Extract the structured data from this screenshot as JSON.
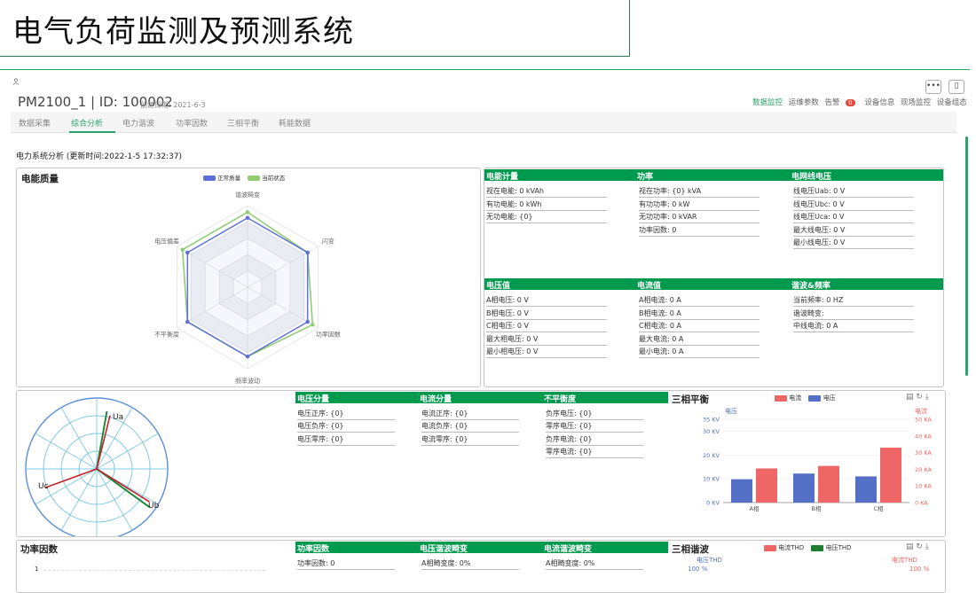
{
  "page_title": "电气负荷监测及预测系统",
  "device": {
    "title": "PM2100_1 | ID: 100002",
    "created": "创建日期: 2021-6-3"
  },
  "top_buttons": [
    "•••",
    "▯"
  ],
  "right_nav": [
    "数据监控",
    "运维参数",
    "告警",
    "设备信息",
    "现场监控",
    "设备组态"
  ],
  "alarm_count": "0",
  "tabs": [
    "数据采集",
    "综合分析",
    "电力谐波",
    "功率因数",
    "三相平衡",
    "耗能数据"
  ],
  "analysis_title": "电力系统分析 (更新时间:2022-1-5 17:32:37)",
  "power_quality": {
    "title": "电能质量",
    "legend": [
      "正常质量",
      "当前状态"
    ],
    "axes": [
      "谐波畸变",
      "闪变",
      "功率因数",
      "频率波动",
      "不平衡度",
      "电压偏差"
    ],
    "normal": [
      0.85,
      0.85,
      0.85,
      0.85,
      0.85,
      0.85
    ],
    "current": [
      0.92,
      0.85,
      0.92,
      0.85,
      0.85,
      0.92
    ]
  },
  "energy": {
    "head": "电能计量",
    "rows": [
      "视在电能: 0 kVAh",
      "有功电能: 0 kWh",
      "无功电能: {0}"
    ]
  },
  "power": {
    "head": "功率",
    "rows": [
      "视在功率: {0} kVA",
      "有功功率: 0 kW",
      "无功功率: 0 kVAR",
      "功率因数: 0"
    ]
  },
  "line_voltage": {
    "head": "电网线电压",
    "rows": [
      "线电压Uab: 0 V",
      "线电压Ubc: 0 V",
      "线电压Uca: 0 V",
      "最大线电压: 0 V",
      "最小线电压: 0 V"
    ]
  },
  "voltage": {
    "head": "电压值",
    "rows": [
      "A相电压: 0 V",
      "B相电压: 0 V",
      "C相电压: 0 V",
      "最大相电压: 0 V",
      "最小相电压: 0 V"
    ]
  },
  "current_val": {
    "head": "电流值",
    "rows": [
      "A相电流: 0 A",
      "B相电流: 0 A",
      "C相电流: 0 A",
      "最大电流: 0 A",
      "最小电流: 0 A"
    ]
  },
  "harmonic_freq": {
    "head": "谐波&频率",
    "rows": [
      "当前频率: 0 HZ",
      "谐波畸变:",
      "中线电流: 0 A"
    ]
  },
  "phasor": {
    "labels": [
      "Ua",
      "Uc",
      "Ub"
    ]
  },
  "voltage_comp": {
    "head": "电压分量",
    "rows": [
      "电压正序: {0}",
      "电压负序: {0}",
      "电压零序: {0}"
    ]
  },
  "current_comp": {
    "head": "电流分量",
    "rows": [
      "电流正序: {0}",
      "电流负序: {0}",
      "电流零序: {0}"
    ]
  },
  "unbalance": {
    "head": "不平衡度",
    "rows": [
      "负序电压: {0}",
      "零序电压: {0}",
      "负序电流: {0}",
      "零序电流: {0}"
    ]
  },
  "three_phase": {
    "title": "三相平衡",
    "legend": [
      "电流",
      "电压"
    ],
    "left_unit": "电压",
    "right_unit": "电流"
  },
  "pf_panel": {
    "title": "功率因数",
    "axis_first": "1"
  },
  "pf_comp": {
    "head": "功率因数",
    "rows": [
      "功率因数: 0"
    ]
  },
  "v_thd": {
    "head": "电压谐波畸变",
    "rows": [
      "A相畸变度: 0%"
    ]
  },
  "i_thd": {
    "head": "电流谐波畸变",
    "rows": [
      "A相畸变度: 0%"
    ]
  },
  "three_harm": {
    "title": "三相谐波",
    "legend": [
      "电流THD",
      "电压THD"
    ],
    "left_unit": "电压THD",
    "right_unit": "电流THD",
    "left_top": "100 %",
    "right_top": "100 %"
  },
  "colors": {
    "accent": "#009a4e",
    "voltage": "#5470c6",
    "current": "#ee6666",
    "normal": "#5b6fd6",
    "current_state": "#91cc75"
  },
  "chart_data": [
    {
      "type": "bar",
      "title": "三相平衡",
      "categories": [
        "A相",
        "B相",
        "C相"
      ],
      "series": [
        {
          "name": "电压",
          "axis": "left",
          "values": [
            9.8,
            12.2,
            11.0
          ]
        },
        {
          "name": "电流",
          "axis": "right",
          "values": [
            20.5,
            22.0,
            33.0
          ]
        }
      ],
      "y_left": {
        "label": "电压",
        "ticks": [
          "0 KV",
          "10 KV",
          "20 KV",
          "30 KV",
          "35 KV"
        ],
        "tick_values": [
          0,
          10,
          20,
          30,
          35
        ],
        "range": [
          0,
          35
        ]
      },
      "y_right": {
        "label": "电流",
        "ticks": [
          "0 KA",
          "10 KA",
          "20 KA",
          "30 KA",
          "40 KA",
          "50 KA"
        ],
        "tick_values": [
          0,
          10,
          20,
          30,
          40,
          50
        ],
        "range": [
          0,
          50
        ]
      },
      "legend": "top-right",
      "grid": true
    }
  ]
}
